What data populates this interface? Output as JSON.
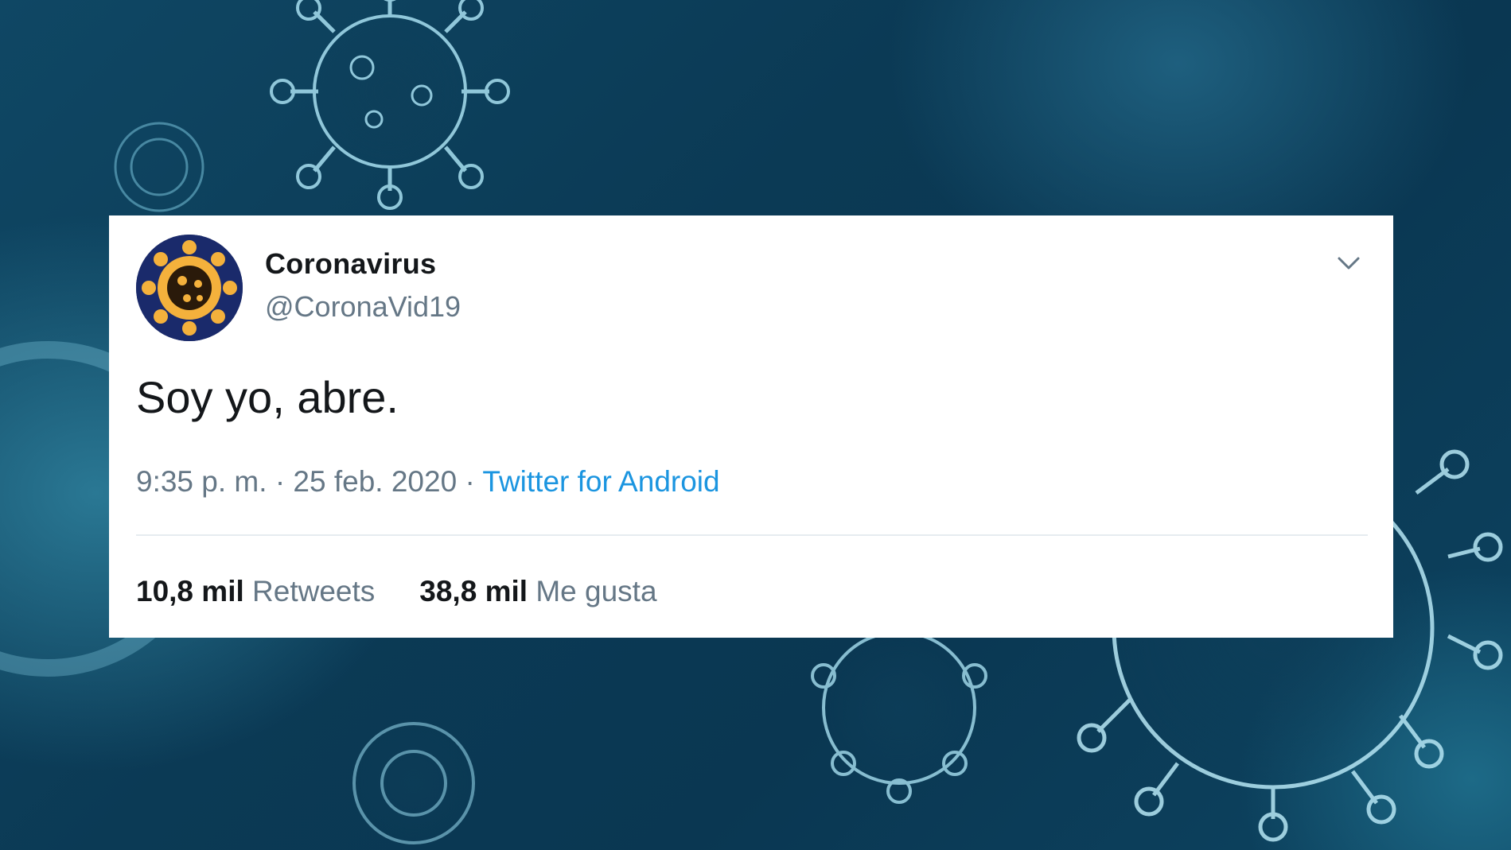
{
  "tweet": {
    "display_name": "Coronavirus",
    "handle": "@CoronaVid19",
    "text": "Soy yo, abre.",
    "time": "9:35 p. m.",
    "separator": "·",
    "date": "25 feb. 2020",
    "source": "Twitter for Android",
    "retweets_count": "10,8 mil",
    "retweets_label": "Retweets",
    "likes_count": "38,8 mil",
    "likes_label": "Me gusta"
  },
  "icons": {
    "menu": "chevron-down-icon",
    "avatar": "coronavirus-avatar"
  },
  "colors": {
    "card_bg": "#ffffff",
    "text_primary": "#14171a",
    "text_secondary": "#657786",
    "link": "#1b95e0",
    "divider": "#e6ecf0",
    "background": "#0b3a55"
  }
}
